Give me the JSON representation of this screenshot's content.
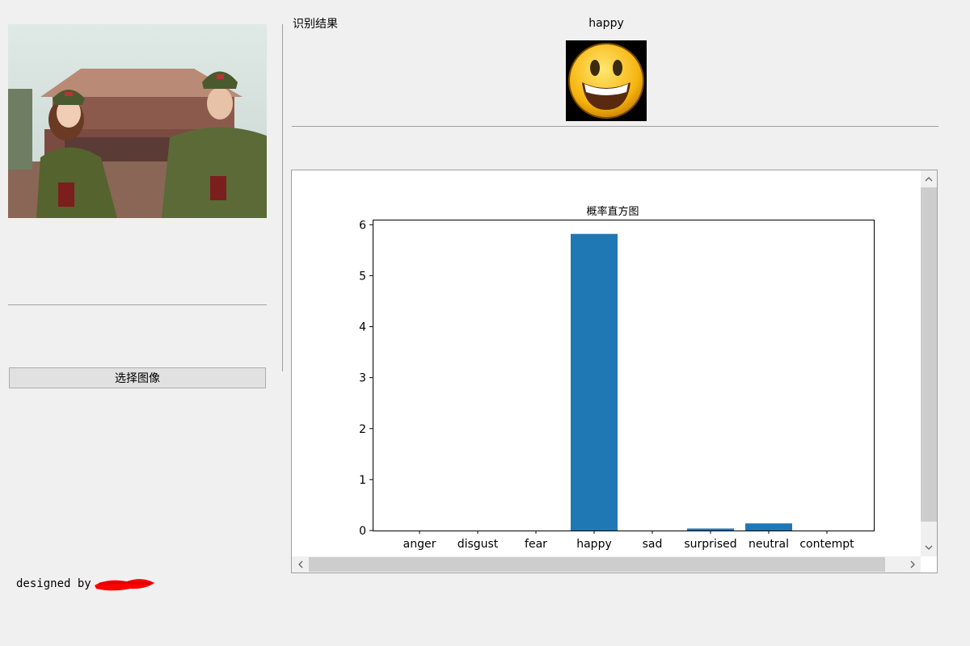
{
  "left_panel": {
    "select_button_label": "选择图像",
    "designed_by_label": "designed by"
  },
  "result": {
    "title": "识别结果",
    "emotion": "happy",
    "emoji_icon": "smiling-face-icon"
  },
  "chart_data": {
    "type": "bar",
    "title": "概率直方图",
    "categories": [
      "anger",
      "disgust",
      "fear",
      "happy",
      "sad",
      "surprised",
      "neutral",
      "contempt"
    ],
    "values": [
      0.0,
      0.0,
      0.0,
      5.82,
      0.0,
      0.04,
      0.14,
      0.0
    ],
    "yticks": [
      "0",
      "1",
      "2",
      "3",
      "4",
      "5",
      "6"
    ],
    "ylim": [
      0,
      6.1
    ],
    "bar_color": "#1f77b4",
    "xlabel": "",
    "ylabel": "",
    "grid": false
  },
  "colors": {
    "background": "#f0f0f0",
    "bar": "#1f77b4",
    "redaction": "#ff0000"
  }
}
